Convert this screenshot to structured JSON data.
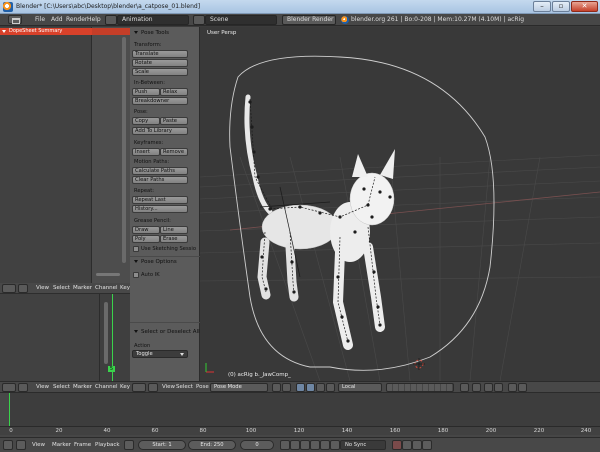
{
  "window": {
    "title": "Blender* [C:\\Users\\abc\\Desktop\\blender\\a_catpose_01.blend]"
  },
  "info_header": {
    "menus": [
      "File",
      "Add",
      "Render",
      "Help"
    ],
    "screen_layout": "Animation",
    "scene": "Scene",
    "render_engine": "Blender Render",
    "stats": "blender.org 261 | Bo:0-208 | Mem:10.27M (4.10M) | acRig"
  },
  "dopesheet": {
    "summary_label": "DopeSheet Summary",
    "current_frame": "5",
    "header_menus": [
      "View",
      "Select",
      "Marker",
      "Channel",
      "Key"
    ]
  },
  "graph": {
    "current_frame": "5"
  },
  "toolshelf": {
    "pose_tools_title": "Pose Tools",
    "transform_label": "Transform:",
    "translate": "Translate",
    "rotate": "Rotate",
    "scale": "Scale",
    "in_between_label": "In-Between:",
    "push": "Push",
    "relax": "Relax",
    "breakdowner": "Breakdowner",
    "pose_label": "Pose:",
    "copy": "Copy",
    "paste": "Paste",
    "add_to_library": "Add To Library",
    "keyframes_label": "Keyframes:",
    "insert": "Insert",
    "remove": "Remove",
    "motion_paths_label": "Motion Paths:",
    "calculate_paths": "Calculate Paths",
    "clear_paths": "Clear Paths",
    "repeat_label": "Repeat:",
    "repeat_last": "Repeat Last",
    "history": "History...",
    "grease_pencil_label": "Grease Pencil:",
    "draw": "Draw",
    "line": "Line",
    "poly": "Poly",
    "erase": "Erase",
    "use_sketching": "Use Sketching Sessio",
    "pose_options_title": "Pose Options",
    "auto_ik": "Auto IK",
    "select_deselect_title": "Select or Deselect All",
    "action_label": "Action",
    "action_value": "Toggle"
  },
  "viewport": {
    "view_label": "User Persp",
    "object_label": "(0) acRig b._JawComp_",
    "header_menus": [
      "View",
      "Select",
      "Pose"
    ],
    "mode": "Pose Mode",
    "transform_orientation": "Local"
  },
  "timeline": {
    "ticks": [
      "0",
      "20",
      "40",
      "60",
      "80",
      "100",
      "120",
      "140",
      "160",
      "180",
      "200",
      "220",
      "240"
    ],
    "header_menus": [
      "View",
      "Marker",
      "Frame",
      "Playback"
    ],
    "start": "Start: 1",
    "end": "End: 250",
    "current": "0",
    "sync": "No Sync"
  },
  "colors": {
    "accent_red": "#d8412a",
    "frame_green": "#3ad34b",
    "viewport_bg": "#393939"
  }
}
